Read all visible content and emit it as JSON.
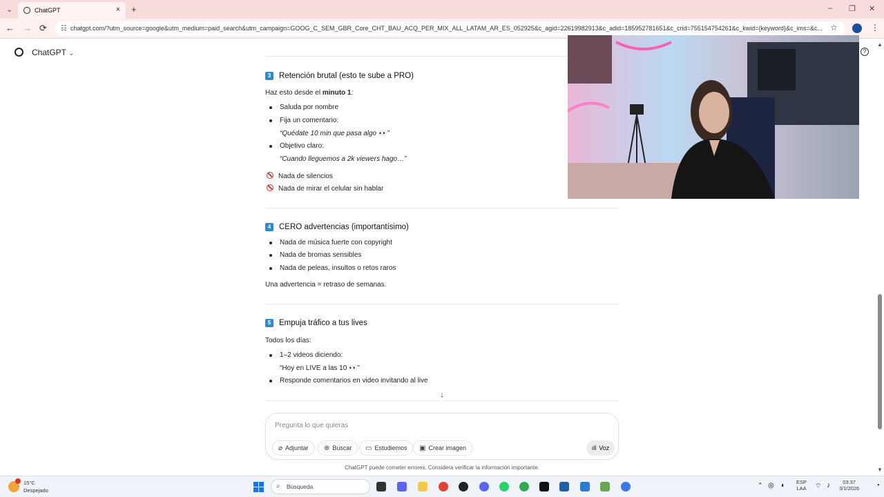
{
  "browser": {
    "tab_title": "ChatGPT",
    "tab_close": "×",
    "new_tab": "+",
    "url": "chatgpt.com/?utm_source=google&utm_medium=paid_search&utm_campaign=GOOG_C_SEM_GBR_Core_CHT_BAU_ACQ_PER_MIX_ALL_LATAM_AR_ES_052925&c_agid=22619982913&c_adid=185952781651&c_crid=755154754261&c_kwid={keyword}&c_ims=&c...",
    "window_controls": [
      "–",
      "❐",
      "✕"
    ],
    "nav": {
      "back": "←",
      "forward": "→",
      "reload": "⟳"
    }
  },
  "app": {
    "title": "ChatGPT",
    "title_chevron": "⌄",
    "help": "?"
  },
  "sections": {
    "s3": {
      "num": "3",
      "title": "Retención brutal (esto te sube a PRO)",
      "intro_pre": "Haz esto desde el ",
      "intro_bold": "minuto 1",
      "intro_post": ":",
      "b1": "Saluda por nombre",
      "b2": "Fija un comentario:",
      "b2_quote": "“Quédate 10 min que pasa algo 👀”",
      "b3": "Objetivo claro:",
      "b3_quote": "“Cuando lleguemos a 2k viewers hago…”",
      "ban1": "Nada de silencios",
      "ban2": "Nada de mirar el celular sin hablar"
    },
    "s4": {
      "num": "4",
      "title": "CERO advertencias (importantísimo)",
      "b1": "Nada de música fuerte con copyright",
      "b2": "Nada de bromas sensibles",
      "b3": "Nada de peleas, insultos o retos raros",
      "note": "Una advertencia = retraso de semanas."
    },
    "s5": {
      "num": "5",
      "title": "Empuja tráfico a tus lives",
      "intro": "Todos los días:",
      "b1": "1–2 videos diciendo:",
      "b1_quote": "“Hoy en LIVE a las 10 👀”",
      "b2": "Responde comentarios en video invitando al live"
    }
  },
  "composer": {
    "placeholder": "Pregunta lo que quieras",
    "buttons": {
      "attach": "Adjuntar",
      "search": "Buscar",
      "study": "Estudiemos",
      "image": "Crear imagen"
    },
    "voice": "Voz"
  },
  "disclaimer": "ChatGPT puede cometer errores. Considera verificar la información importante.",
  "taskbar": {
    "weather_temp": "15°C",
    "weather_desc": "Despejado",
    "search": "Búsqueda",
    "lang_top": "ESP",
    "lang_bottom": "LAA",
    "time": "03:37",
    "date": "3/1/2026"
  }
}
